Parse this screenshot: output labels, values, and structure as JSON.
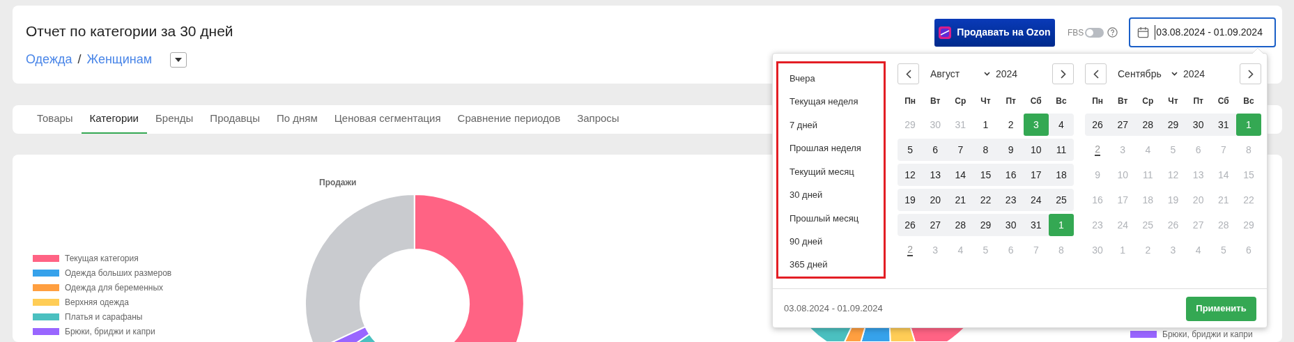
{
  "header": {
    "title": "Отчет по категории за 30 дней",
    "breadcrumb": [
      "Одежда",
      "Женщинам"
    ],
    "separator": "/"
  },
  "toolbar": {
    "ozon_button": "Продавать на Ozon",
    "fbs": {
      "label": "FBS",
      "on": false
    },
    "date_field": {
      "value": "03.08.2024 - 01.09.2024"
    }
  },
  "tabs": [
    {
      "label": "Товары",
      "selected": false
    },
    {
      "label": "Категории",
      "selected": true
    },
    {
      "label": "Бренды",
      "selected": false
    },
    {
      "label": "Продавцы",
      "selected": false
    },
    {
      "label": "По дням",
      "selected": false
    },
    {
      "label": "Ценовая сегментация",
      "selected": false
    },
    {
      "label": "Сравнение периодов",
      "selected": false
    },
    {
      "label": "Запросы",
      "selected": false
    }
  ],
  "sales_chart": {
    "title": "Продажи",
    "legend": [
      {
        "label": "Текущая категория",
        "color": "#ff6384"
      },
      {
        "label": "Одежда больших размеров",
        "color": "#36a2eb"
      },
      {
        "label": "Одежда для беременных",
        "color": "#ff9f40"
      },
      {
        "label": "Верхняя одежда",
        "color": "#ffcd56"
      },
      {
        "label": "Платья и сарафаны",
        "color": "#4bc0c0"
      },
      {
        "label": "Брюки, бриджи и капри",
        "color": "#9966ff"
      }
    ]
  },
  "second_chart": {
    "legend": [
      {
        "label": "Брюки, бриджи и капри",
        "color": "#9966ff"
      }
    ]
  },
  "date_picker": {
    "presets": [
      "Вчера",
      "Текущая неделя",
      "7 дней",
      "Прошлая неделя",
      "Текущий месяц",
      "30 дней",
      "Прошлый месяц",
      "90 дней",
      "365 дней"
    ],
    "months": [
      {
        "month": "Август",
        "year": "2024",
        "weekdays": [
          "Пн",
          "Вт",
          "Ср",
          "Чт",
          "Пт",
          "Сб",
          "Вс"
        ],
        "weeks": [
          [
            {
              "d": "29",
              "kind": "muted"
            },
            {
              "d": "30",
              "kind": "muted"
            },
            {
              "d": "31",
              "kind": "muted"
            },
            {
              "d": "1",
              "kind": "plain"
            },
            {
              "d": "2",
              "kind": "plain"
            },
            {
              "d": "3",
              "kind": "edge"
            },
            {
              "d": "4",
              "kind": "range"
            }
          ],
          [
            {
              "d": "5",
              "kind": "range"
            },
            {
              "d": "6",
              "kind": "range"
            },
            {
              "d": "7",
              "kind": "range"
            },
            {
              "d": "8",
              "kind": "range"
            },
            {
              "d": "9",
              "kind": "range"
            },
            {
              "d": "10",
              "kind": "range"
            },
            {
              "d": "11",
              "kind": "range"
            }
          ],
          [
            {
              "d": "12",
              "kind": "range"
            },
            {
              "d": "13",
              "kind": "range"
            },
            {
              "d": "14",
              "kind": "range"
            },
            {
              "d": "15",
              "kind": "range"
            },
            {
              "d": "16",
              "kind": "range"
            },
            {
              "d": "17",
              "kind": "range"
            },
            {
              "d": "18",
              "kind": "range"
            }
          ],
          [
            {
              "d": "19",
              "kind": "range"
            },
            {
              "d": "20",
              "kind": "range"
            },
            {
              "d": "21",
              "kind": "range"
            },
            {
              "d": "22",
              "kind": "range"
            },
            {
              "d": "23",
              "kind": "range"
            },
            {
              "d": "24",
              "kind": "range"
            },
            {
              "d": "25",
              "kind": "range"
            }
          ],
          [
            {
              "d": "26",
              "kind": "range"
            },
            {
              "d": "27",
              "kind": "range"
            },
            {
              "d": "28",
              "kind": "range"
            },
            {
              "d": "29",
              "kind": "range"
            },
            {
              "d": "30",
              "kind": "range"
            },
            {
              "d": "31",
              "kind": "range"
            },
            {
              "d": "1",
              "kind": "edge"
            }
          ],
          [
            {
              "d": "2",
              "kind": "today"
            },
            {
              "d": "3",
              "kind": "muted"
            },
            {
              "d": "4",
              "kind": "muted"
            },
            {
              "d": "5",
              "kind": "muted"
            },
            {
              "d": "6",
              "kind": "muted"
            },
            {
              "d": "7",
              "kind": "muted"
            },
            {
              "d": "8",
              "kind": "muted"
            }
          ]
        ]
      },
      {
        "month": "Сентябрь",
        "year": "2024",
        "weekdays": [
          "Пн",
          "Вт",
          "Ср",
          "Чт",
          "Пт",
          "Сб",
          "Вс"
        ],
        "weeks": [
          [
            {
              "d": "26",
              "kind": "range"
            },
            {
              "d": "27",
              "kind": "range"
            },
            {
              "d": "28",
              "kind": "range"
            },
            {
              "d": "29",
              "kind": "range"
            },
            {
              "d": "30",
              "kind": "range"
            },
            {
              "d": "31",
              "kind": "range"
            },
            {
              "d": "1",
              "kind": "edge"
            }
          ],
          [
            {
              "d": "2",
              "kind": "today"
            },
            {
              "d": "3",
              "kind": "muted"
            },
            {
              "d": "4",
              "kind": "muted"
            },
            {
              "d": "5",
              "kind": "muted"
            },
            {
              "d": "6",
              "kind": "muted"
            },
            {
              "d": "7",
              "kind": "muted"
            },
            {
              "d": "8",
              "kind": "muted"
            }
          ],
          [
            {
              "d": "9",
              "kind": "muted"
            },
            {
              "d": "10",
              "kind": "muted"
            },
            {
              "d": "11",
              "kind": "muted"
            },
            {
              "d": "12",
              "kind": "muted"
            },
            {
              "d": "13",
              "kind": "muted"
            },
            {
              "d": "14",
              "kind": "muted"
            },
            {
              "d": "15",
              "kind": "muted"
            }
          ],
          [
            {
              "d": "16",
              "kind": "muted"
            },
            {
              "d": "17",
              "kind": "muted"
            },
            {
              "d": "18",
              "kind": "muted"
            },
            {
              "d": "19",
              "kind": "muted"
            },
            {
              "d": "20",
              "kind": "muted"
            },
            {
              "d": "21",
              "kind": "muted"
            },
            {
              "d": "22",
              "kind": "muted"
            }
          ],
          [
            {
              "d": "23",
              "kind": "muted"
            },
            {
              "d": "24",
              "kind": "muted"
            },
            {
              "d": "25",
              "kind": "muted"
            },
            {
              "d": "26",
              "kind": "muted"
            },
            {
              "d": "27",
              "kind": "muted"
            },
            {
              "d": "28",
              "kind": "muted"
            },
            {
              "d": "29",
              "kind": "muted"
            }
          ],
          [
            {
              "d": "30",
              "kind": "muted"
            },
            {
              "d": "1",
              "kind": "muted"
            },
            {
              "d": "2",
              "kind": "muted"
            },
            {
              "d": "3",
              "kind": "muted"
            },
            {
              "d": "4",
              "kind": "muted"
            },
            {
              "d": "5",
              "kind": "muted"
            },
            {
              "d": "6",
              "kind": "muted"
            }
          ]
        ]
      }
    ],
    "footer_range": "03.08.2024 - 01.09.2024",
    "apply_button": "Применить"
  }
}
